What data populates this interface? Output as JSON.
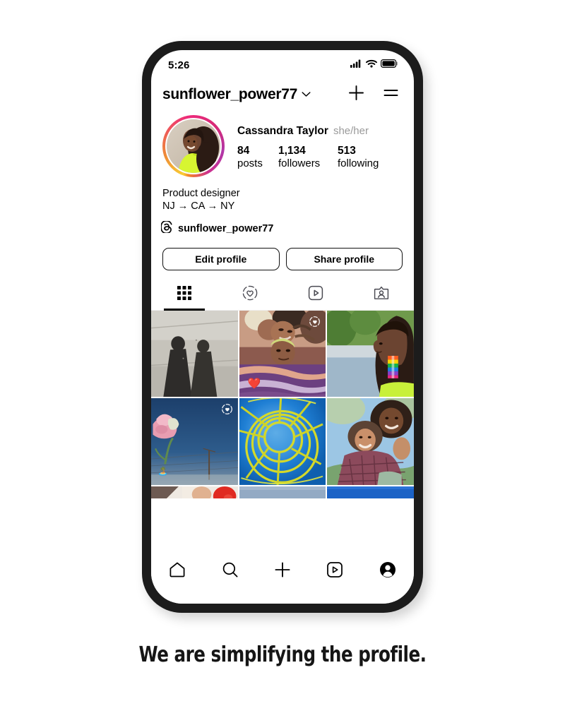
{
  "canvas": {
    "background": "#ffffff",
    "caption": "We are simplifying the profile."
  },
  "phone": {
    "frame_color": "#1c1c1c",
    "screen_color": "#ffffff"
  },
  "status_bar": {
    "time": "5:26",
    "icons": [
      "cellular-signal-icon",
      "wifi-icon",
      "battery-icon"
    ]
  },
  "header": {
    "username": "sunflower_power77",
    "chevron_icon": "chevron-down-icon",
    "actions": [
      {
        "name": "new-post-button",
        "icon": "plus-icon"
      },
      {
        "name": "menu-button",
        "icon": "hamburger-menu-icon"
      }
    ]
  },
  "profile": {
    "avatar": {
      "alt": "profile-photo",
      "has_story_ring": true,
      "ring_colors": [
        "#f9ce34",
        "#ee2a7b",
        "#b036a8",
        "#f58529"
      ]
    },
    "display_name": "Cassandra Taylor",
    "pronouns": "she/her",
    "stats": [
      {
        "value": "84",
        "label": "posts"
      },
      {
        "value": "1,134",
        "label": "followers"
      },
      {
        "value": "513",
        "label": "following"
      }
    ],
    "bio_lines": [
      "Product designer",
      "NJ → CA → NY"
    ],
    "threads": {
      "icon": "threads-logo-icon",
      "handle": "sunflower_power77"
    }
  },
  "action_buttons": [
    {
      "label": "Edit profile",
      "name": "edit-profile-button"
    },
    {
      "label": "Share profile",
      "name": "share-profile-button"
    }
  ],
  "tabs": [
    {
      "name": "tab-grid",
      "icon": "grid-icon",
      "active": true
    },
    {
      "name": "tab-saved-collections",
      "icon": "heart-dashed-circle-icon",
      "active": false
    },
    {
      "name": "tab-reels",
      "icon": "reels-play-icon",
      "active": false
    },
    {
      "name": "tab-tagged",
      "icon": "tagged-person-icon",
      "active": false
    }
  ],
  "grid": {
    "rows": [
      [
        {
          "name": "post-shadows-on-pavement",
          "badge": null,
          "emoji": null
        },
        {
          "name": "post-friends-lying-down",
          "badge": "heart-dashed-circle-icon",
          "emoji": "❤️"
        },
        {
          "name": "post-woman-profile-earring",
          "badge": null,
          "emoji": null
        }
      ],
      [
        {
          "name": "post-pink-flower-sky",
          "badge": "heart-dashed-circle-icon",
          "emoji": "🏝️"
        },
        {
          "name": "post-yellow-spiral-structure",
          "badge": null,
          "emoji": null
        },
        {
          "name": "post-two-friends-hugging",
          "badge": null,
          "emoji": null
        }
      ],
      [
        {
          "name": "post-partial-left",
          "badge": null,
          "emoji": null
        },
        {
          "name": "post-partial-middle",
          "badge": null,
          "emoji": null
        },
        {
          "name": "post-partial-right",
          "badge": null,
          "emoji": null
        }
      ]
    ]
  },
  "bottom_nav": [
    {
      "name": "nav-home",
      "icon": "home-icon",
      "active": false
    },
    {
      "name": "nav-search",
      "icon": "search-icon",
      "active": false
    },
    {
      "name": "nav-create",
      "icon": "plus-icon",
      "active": false
    },
    {
      "name": "nav-reels",
      "icon": "reels-play-icon",
      "active": false
    },
    {
      "name": "nav-profile",
      "icon": "profile-avatar-icon",
      "active": true
    }
  ]
}
